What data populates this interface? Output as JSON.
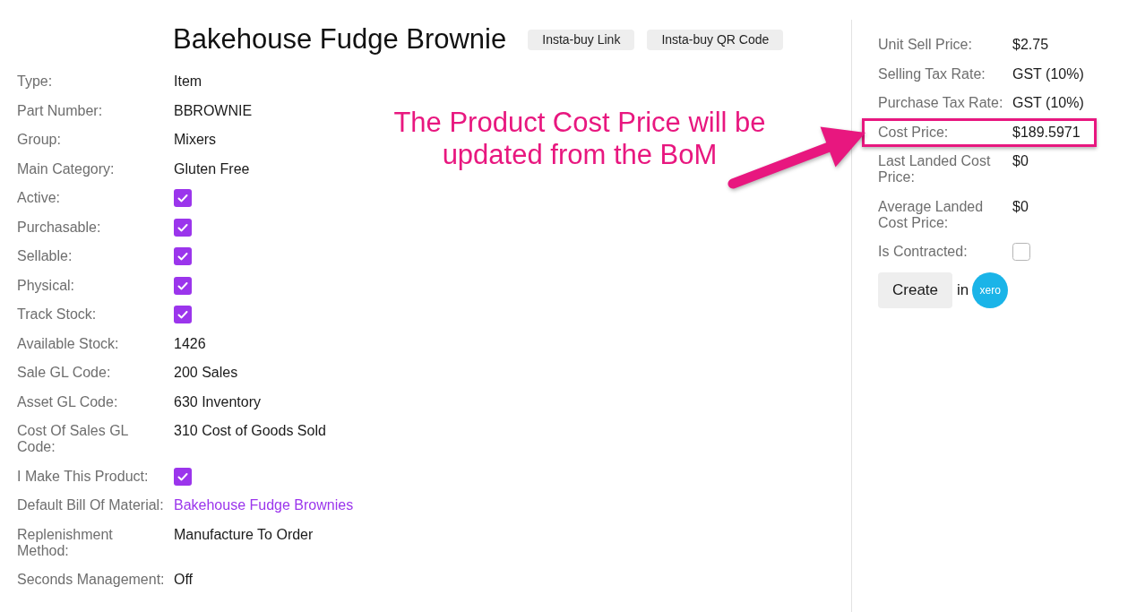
{
  "product": {
    "title": "Bakehouse Fudge Brownie",
    "actions": [
      "Insta-buy Link",
      "Insta-buy QR Code"
    ]
  },
  "fields": [
    {
      "label": "Type:",
      "kind": "text",
      "value": "Item"
    },
    {
      "label": "Part Number:",
      "kind": "text",
      "value": "BBROWNIE"
    },
    {
      "label": "Group:",
      "kind": "text",
      "value": "Mixers"
    },
    {
      "label": "Main Category:",
      "kind": "text",
      "value": "Gluten Free"
    },
    {
      "label": "Active:",
      "kind": "checkbox",
      "checked": true
    },
    {
      "label": "Purchasable:",
      "kind": "checkbox",
      "checked": true
    },
    {
      "label": "Sellable:",
      "kind": "checkbox",
      "checked": true
    },
    {
      "label": "Physical:",
      "kind": "checkbox",
      "checked": true
    },
    {
      "label": "Track Stock:",
      "kind": "checkbox",
      "checked": true
    },
    {
      "label": "Available Stock:",
      "kind": "text",
      "value": "1426"
    },
    {
      "label": "Sale GL Code:",
      "kind": "text",
      "value": "200 Sales"
    },
    {
      "label": "Asset GL Code:",
      "kind": "text",
      "value": "630 Inventory"
    },
    {
      "label": "Cost Of Sales GL Code:",
      "kind": "text",
      "value": "310 Cost of Goods Sold"
    },
    {
      "label": "I Make This Product:",
      "kind": "checkbox",
      "checked": true
    },
    {
      "label": "Default Bill Of Material:",
      "kind": "link",
      "value": "Bakehouse Fudge Brownies"
    },
    {
      "label": "Replenishment Method:",
      "kind": "text",
      "value": "Manufacture To Order"
    },
    {
      "label": "Seconds Management:",
      "kind": "text",
      "value": "Off"
    }
  ],
  "price_fields": [
    {
      "label": "Unit Sell Price:",
      "kind": "text",
      "value": "$2.75",
      "highlighted": false
    },
    {
      "label": "Selling Tax Rate:",
      "kind": "text",
      "value": "GST (10%)",
      "highlighted": false
    },
    {
      "label": "Purchase Tax Rate:",
      "kind": "text",
      "value": "GST (10%)",
      "highlighted": false
    },
    {
      "label": "Cost Price:",
      "kind": "text",
      "value": "$189.5971",
      "highlighted": true
    },
    {
      "label": "Last Landed Cost Price:",
      "kind": "text",
      "value": "$0",
      "highlighted": false
    },
    {
      "label": "Average Landed Cost Price:",
      "kind": "text",
      "value": "$0",
      "highlighted": false
    },
    {
      "label": "Is Contracted:",
      "kind": "checkbox",
      "checked": false,
      "highlighted": false
    }
  ],
  "accounting_sync": {
    "button": "Create",
    "connector": "in",
    "logo_text": "xero"
  },
  "annotation": {
    "text": "The Product Cost Price will be updated from the BoM"
  }
}
